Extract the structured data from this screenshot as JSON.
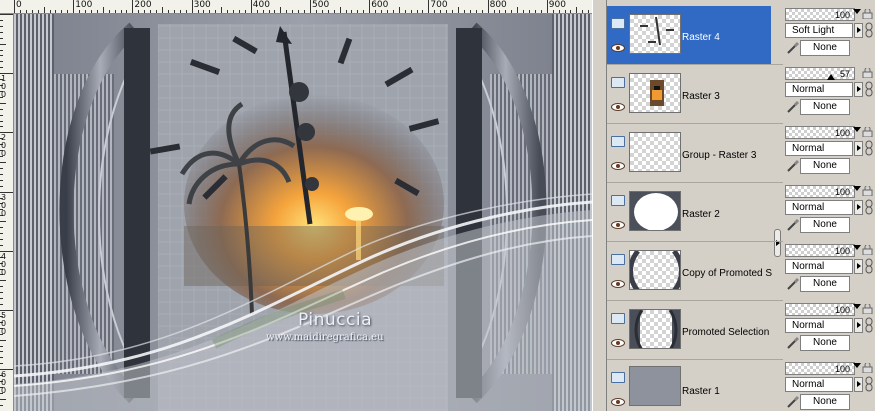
{
  "ruler": {
    "h_labels": [
      "0",
      "100",
      "200",
      "300",
      "400",
      "500",
      "600",
      "700",
      "800",
      "900"
    ],
    "v_labels": [
      "1\n0\n0",
      "2\n0\n0",
      "3\n0\n0",
      "4\n0\n0",
      "5\n0\n0",
      "6\n0\n0"
    ]
  },
  "canvas": {
    "watermark_title": "Pinuccia",
    "watermark_url": "www.maidiregrafica.eu"
  },
  "layers": [
    {
      "name": "Raster 4",
      "selected": true,
      "opacity": "100",
      "blend_mode": "Soft Light",
      "mask": "None",
      "thumb": "clock-hands"
    },
    {
      "name": "Raster 3",
      "selected": false,
      "opacity": "57",
      "blend_mode": "Normal",
      "mask": "None",
      "thumb": "sunset-tube"
    },
    {
      "name": "Group - Raster 3",
      "selected": false,
      "opacity": "100",
      "blend_mode": "Normal",
      "mask": "None",
      "thumb": "transparent"
    },
    {
      "name": "Raster 2",
      "selected": false,
      "opacity": "100",
      "blend_mode": "Normal",
      "mask": "None",
      "thumb": "frame-oval"
    },
    {
      "name": "Copy of Promoted Se",
      "selected": false,
      "opacity": "100",
      "blend_mode": "Normal",
      "mask": "None",
      "thumb": "arcs"
    },
    {
      "name": "Promoted Selection",
      "selected": false,
      "opacity": "100",
      "blend_mode": "Normal",
      "mask": "None",
      "thumb": "arcs-dark"
    },
    {
      "name": "Raster 1",
      "selected": false,
      "opacity": "100",
      "blend_mode": "Normal",
      "mask": "None",
      "thumb": "gray-fill"
    }
  ],
  "colors": {
    "selection": "#316ac5",
    "panel_bg": "#d4d0c8",
    "canvas_gray": "#8a8e98"
  }
}
